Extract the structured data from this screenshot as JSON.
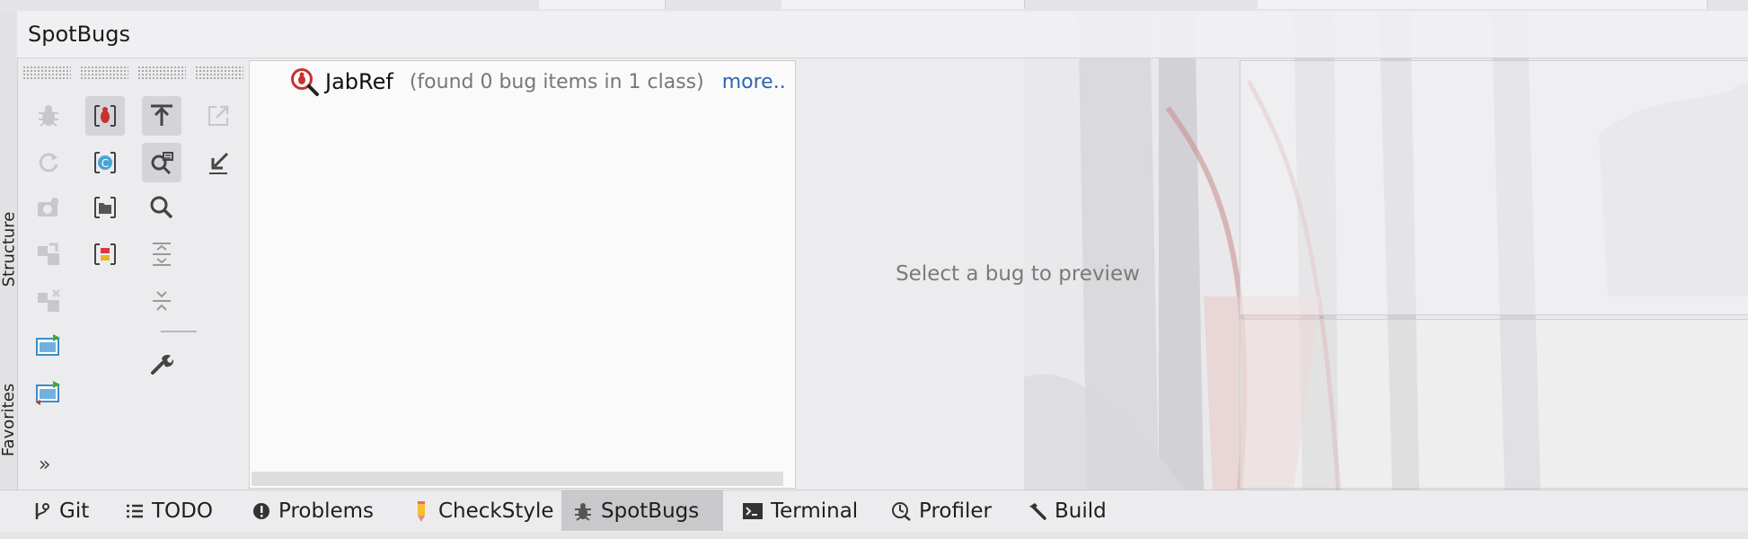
{
  "window": {
    "title": "SpotBugs"
  },
  "side_tabs": {
    "structure": "Structure",
    "favorites": "Favorites"
  },
  "tree": {
    "project": "JabRef",
    "summary": "(found 0 bug items in 1 class)",
    "more_link": "more.."
  },
  "preview": {
    "placeholder": "Select a bug to preview"
  },
  "bottom_tabs": [
    {
      "label": "Git",
      "icon": "git-branch-icon",
      "active": false
    },
    {
      "label": "TODO",
      "icon": "list-icon",
      "active": false
    },
    {
      "label": "Problems",
      "icon": "alert-circle-icon",
      "active": false
    },
    {
      "label": "CheckStyle",
      "icon": "pencil-icon",
      "active": false
    },
    {
      "label": "SpotBugs",
      "icon": "bug-icon",
      "active": true
    },
    {
      "label": "Terminal",
      "icon": "terminal-icon",
      "active": false
    },
    {
      "label": "Profiler",
      "icon": "profiler-icon",
      "active": false
    },
    {
      "label": "Build",
      "icon": "hammer-icon",
      "active": false
    }
  ],
  "toolbar": {
    "expand_symbol": "»",
    "buttons": [
      {
        "icon": "bug-analyze-icon",
        "enabled": false
      },
      {
        "icon": "bug-filter-icon",
        "active": true
      },
      {
        "icon": "export-icon",
        "active": true
      },
      {
        "icon": "open-external-icon",
        "enabled": false
      },
      {
        "icon": "rerun-icon",
        "enabled": false
      },
      {
        "icon": "class-scope-icon"
      },
      {
        "icon": "search-code-icon",
        "active": true
      },
      {
        "icon": "import-icon"
      },
      {
        "icon": "camera-icon",
        "enabled": false
      },
      {
        "icon": "folder-scope-icon"
      },
      {
        "icon": "search-icon"
      },
      {
        "icon": "group-by-icon",
        "enabled": false
      },
      {
        "icon": "priority-icon"
      },
      {
        "icon": "expand-all-icon"
      },
      {
        "icon": "merge-icon",
        "enabled": false
      },
      {
        "icon": "collapse-all-icon"
      },
      {
        "icon": "preview-run-icon"
      },
      {
        "icon": "settings-wrench-icon"
      },
      {
        "icon": "preview-run-error-icon"
      }
    ]
  },
  "colors": {
    "accent": "#2f65ac",
    "bug_red": "#c8322d",
    "active_tab": "#c9c9cc"
  }
}
